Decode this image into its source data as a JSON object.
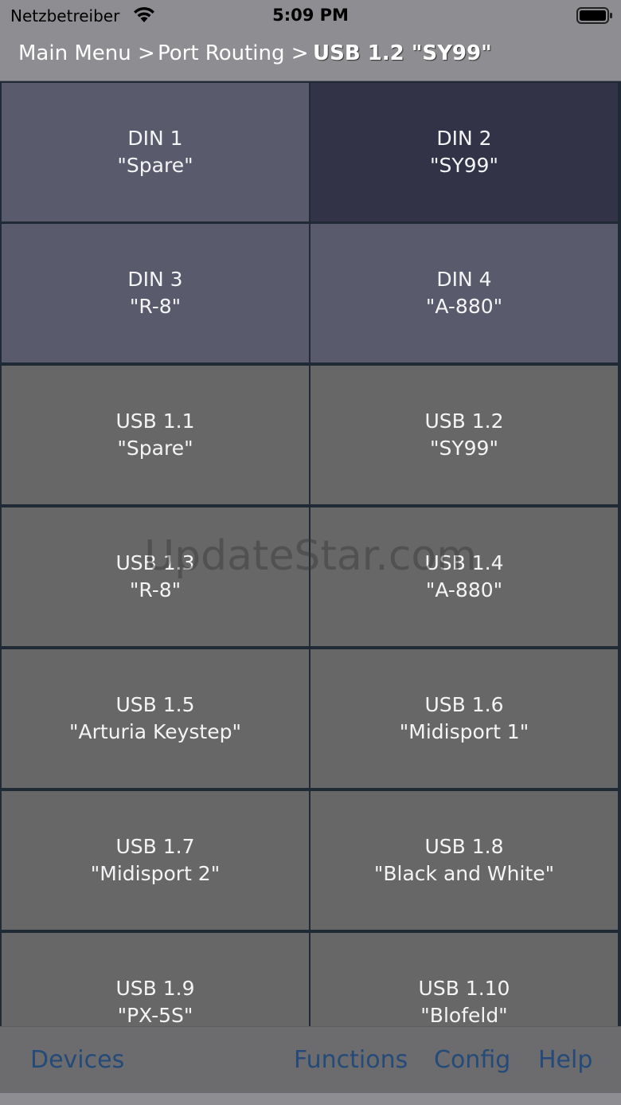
{
  "status": {
    "carrier": "Netzbetreiber",
    "time": "5:09 PM"
  },
  "breadcrumb": {
    "items": [
      "Main Menu >",
      "Port Routing >",
      "USB 1.2 \"SY99\""
    ]
  },
  "ports": [
    {
      "port": "DIN 1",
      "name": "\"Spare\""
    },
    {
      "port": "DIN 2",
      "name": "\"SY99\""
    },
    {
      "port": "DIN 3",
      "name": "\"R-8\""
    },
    {
      "port": "DIN 4",
      "name": "\"A-880\""
    },
    {
      "port": "USB 1.1",
      "name": "\"Spare\""
    },
    {
      "port": "USB 1.2",
      "name": "\"SY99\""
    },
    {
      "port": "USB 1.3",
      "name": "\"R-8\""
    },
    {
      "port": "USB 1.4",
      "name": "\"A-880\""
    },
    {
      "port": "USB 1.5",
      "name": "\"Arturia Keystep\""
    },
    {
      "port": "USB 1.6",
      "name": "\"Midisport 1\""
    },
    {
      "port": "USB 1.7",
      "name": "\"Midisport 2\""
    },
    {
      "port": "USB 1.8",
      "name": "\"Black and White\""
    },
    {
      "port": "USB 1.9",
      "name": "\"PX-5S\""
    },
    {
      "port": "USB 1.10",
      "name": "\"Blofeld\""
    }
  ],
  "watermark": "UpdateStar.com",
  "toolbar": {
    "devices": "Devices",
    "functions": "Functions",
    "config": "Config",
    "help": "Help"
  },
  "colors": {
    "din_cell": "#595a6b",
    "din_selected": "#323346",
    "usb_cell": "#676767",
    "toolbar_text": "#234a78"
  }
}
